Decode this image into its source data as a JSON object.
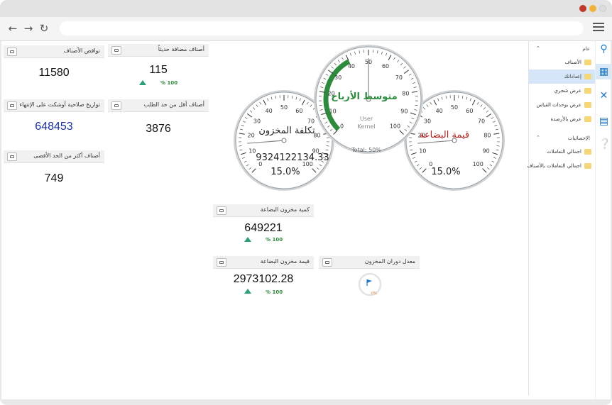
{
  "browser": {
    "window_dots": [
      "#c0392b",
      "#f0b43c",
      "#dddddd"
    ],
    "back_icon": "arrow-left-icon",
    "forward_icon": "arrow-right-icon",
    "reload_icon": "reload-icon",
    "menu_icon": "hamburger-icon"
  },
  "panels": {
    "items_count": {
      "title": "نواقص الأصناف",
      "value": "11580"
    },
    "new_items": {
      "title": "أصناف مضافة حديثاً",
      "value": "115",
      "trend": "% 100"
    },
    "expiry": {
      "title": "تواريخ صلاحية أوشكت على الإنتهاء",
      "value": "648453"
    },
    "below_min": {
      "title": "أصناف أقل من حد الطلب",
      "value": "3876"
    },
    "above_max": {
      "title": "أصناف أكثر من الحد الأقصى",
      "value": "749"
    },
    "stock_qty": {
      "title": "كمية مخزون البضاعة",
      "value": "649221",
      "trend": "% 100"
    },
    "stock_value": {
      "title": "قيمة مخزون البضاعة",
      "value": "2973102.28",
      "trend": "% 100"
    },
    "turnover": {
      "title": "معدل دوران المخزون",
      "percent_label": "0%",
      "fill": 0
    }
  },
  "gauges": {
    "left": {
      "title": "تكلفة المخزون",
      "value": "9324122134.33",
      "percent": "15.0%",
      "needle": 15,
      "ticks": [
        "0",
        "10",
        "20",
        "30",
        "40",
        "50",
        "60",
        "70",
        "80",
        "90",
        "100"
      ]
    },
    "center": {
      "title": "متوسط الأرباح",
      "line1": "User",
      "line2": "Kernel",
      "footer": "Total: 50%",
      "needle": 50,
      "arc_from": 0,
      "arc_to": 40,
      "ticks": [
        "0",
        "10",
        "20",
        "30",
        "40",
        "50",
        "60",
        "70",
        "80",
        "90",
        "100"
      ]
    },
    "right": {
      "title": "قيمة البضاعة",
      "percent": "15.0%",
      "needle": 15,
      "ticks": [
        "0",
        "10",
        "20",
        "30",
        "40",
        "50",
        "60",
        "70",
        "80",
        "90",
        "100"
      ]
    }
  },
  "sidebar": {
    "group1": {
      "label": "عام"
    },
    "items1": [
      {
        "label": "الأصناف"
      },
      {
        "label": "إعداداتك"
      },
      {
        "label": "عرض شجري"
      },
      {
        "label": "عرض بوحدات القياس"
      },
      {
        "label": "عرض بالأرصدة"
      }
    ],
    "group2": {
      "label": "الإحصائيات"
    },
    "items2": [
      {
        "label": "اجمالي التعاملات"
      },
      {
        "label": "اجمالي التعاملات بالأصناف"
      }
    ],
    "selected_index": 1
  },
  "rail": [
    "search-icon",
    "windows-icon",
    "tools-icon",
    "search-doc-icon",
    "help-icon"
  ]
}
